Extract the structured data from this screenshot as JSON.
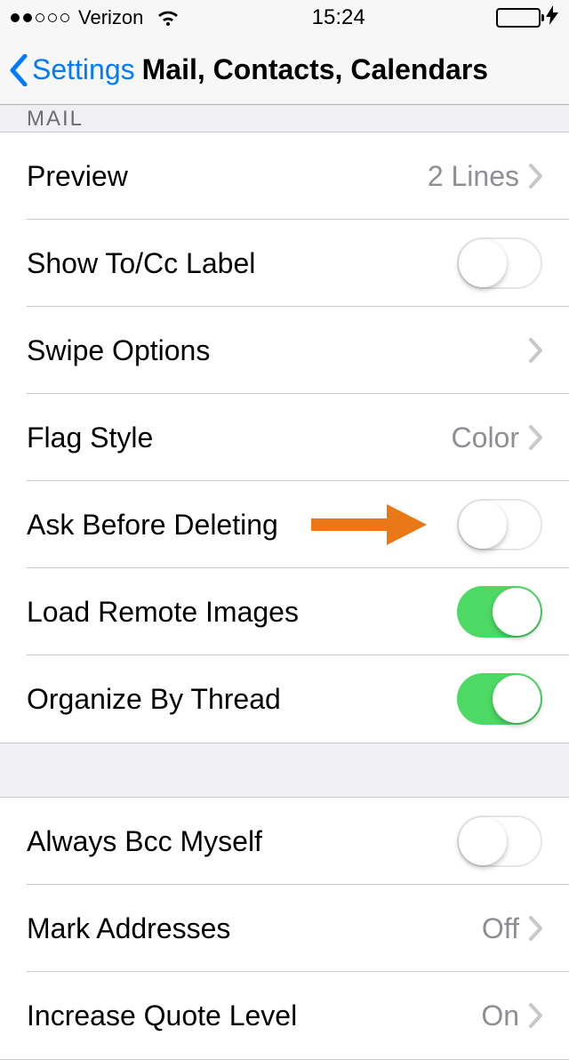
{
  "status_bar": {
    "carrier": "Verizon",
    "time": "15:24"
  },
  "nav": {
    "back_label": "Settings",
    "title": "Mail, Contacts, Calendars"
  },
  "sections": {
    "mail_header": "MAIL",
    "preview": {
      "label": "Preview",
      "value": "2 Lines"
    },
    "show_tocc": {
      "label": "Show To/Cc Label",
      "on": false
    },
    "swipe_options": {
      "label": "Swipe Options"
    },
    "flag_style": {
      "label": "Flag Style",
      "value": "Color"
    },
    "ask_before_deleting": {
      "label": "Ask Before Deleting",
      "on": false
    },
    "load_remote_images": {
      "label": "Load Remote Images",
      "on": true
    },
    "organize_by_thread": {
      "label": "Organize By Thread",
      "on": true
    },
    "always_bcc": {
      "label": "Always Bcc Myself",
      "on": false
    },
    "mark_addresses": {
      "label": "Mark Addresses",
      "value": "Off"
    },
    "increase_quote": {
      "label": "Increase Quote Level",
      "value": "On"
    }
  }
}
